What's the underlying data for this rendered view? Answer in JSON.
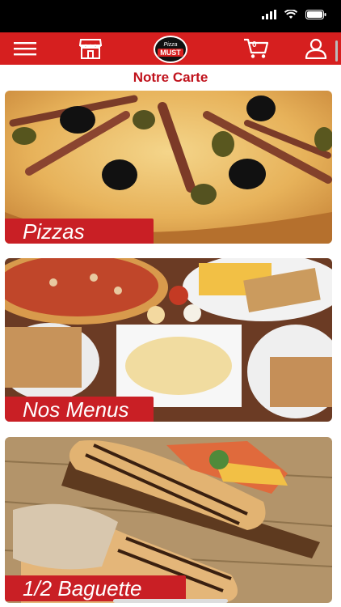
{
  "header": {
    "logo_top": "Pizza",
    "logo_bottom": "MUST",
    "cart_count": "0"
  },
  "page": {
    "title": "Notre Carte"
  },
  "cards": [
    {
      "label": "Pizzas"
    },
    {
      "label": "Nos Menus"
    },
    {
      "label": "1/2 Baguette"
    }
  ],
  "icons": {
    "menu": "hamburger-menu-icon",
    "store": "store-icon",
    "cart": "cart-icon",
    "user": "user-icon"
  },
  "colors": {
    "brand_red": "#d61f1f",
    "label_red": "#c91f25"
  }
}
